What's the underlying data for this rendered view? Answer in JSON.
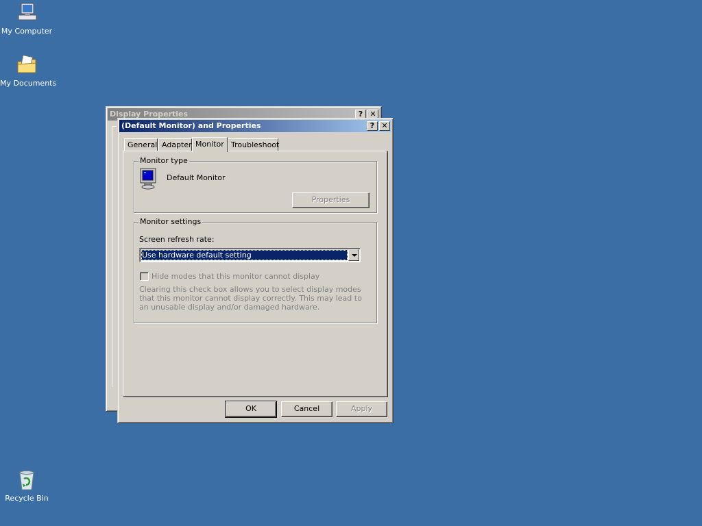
{
  "desktop": {
    "icons": [
      {
        "label": "My Computer",
        "icon": "my-computer-icon"
      },
      {
        "label": "My Documents",
        "icon": "my-documents-icon"
      },
      {
        "label": "Recycle Bin",
        "icon": "recycle-bin-icon"
      }
    ],
    "background_color": "#3a6ea5"
  },
  "back_window": {
    "title": "Display Properties",
    "help": "?",
    "close": "✕"
  },
  "dialog": {
    "title": "(Default Monitor) and  Properties",
    "help": "?",
    "close": "✕",
    "tabs": [
      {
        "label": "General",
        "selected": false
      },
      {
        "label": "Adapter",
        "selected": false
      },
      {
        "label": "Monitor",
        "selected": true
      },
      {
        "label": "Troubleshoot",
        "selected": false
      }
    ],
    "monitor_type": {
      "group_title": "Monitor type",
      "monitor_name": "Default Monitor",
      "properties_button": "Properties"
    },
    "monitor_settings": {
      "group_title": "Monitor settings",
      "refresh_label": "Screen refresh rate:",
      "refresh_value": "Use hardware default setting",
      "hide_modes_label": "Hide modes that this monitor cannot display",
      "hide_modes_checked": false,
      "description": "Clearing this check box allows you to select display modes that this monitor cannot display correctly. This may lead to an unusable display and/or damaged hardware."
    },
    "buttons": {
      "ok": "OK",
      "cancel": "Cancel",
      "apply": "Apply"
    },
    "colors": {
      "title_active": "#0a246a",
      "face": "#d4d0c8",
      "selection": "#0a246a"
    }
  }
}
